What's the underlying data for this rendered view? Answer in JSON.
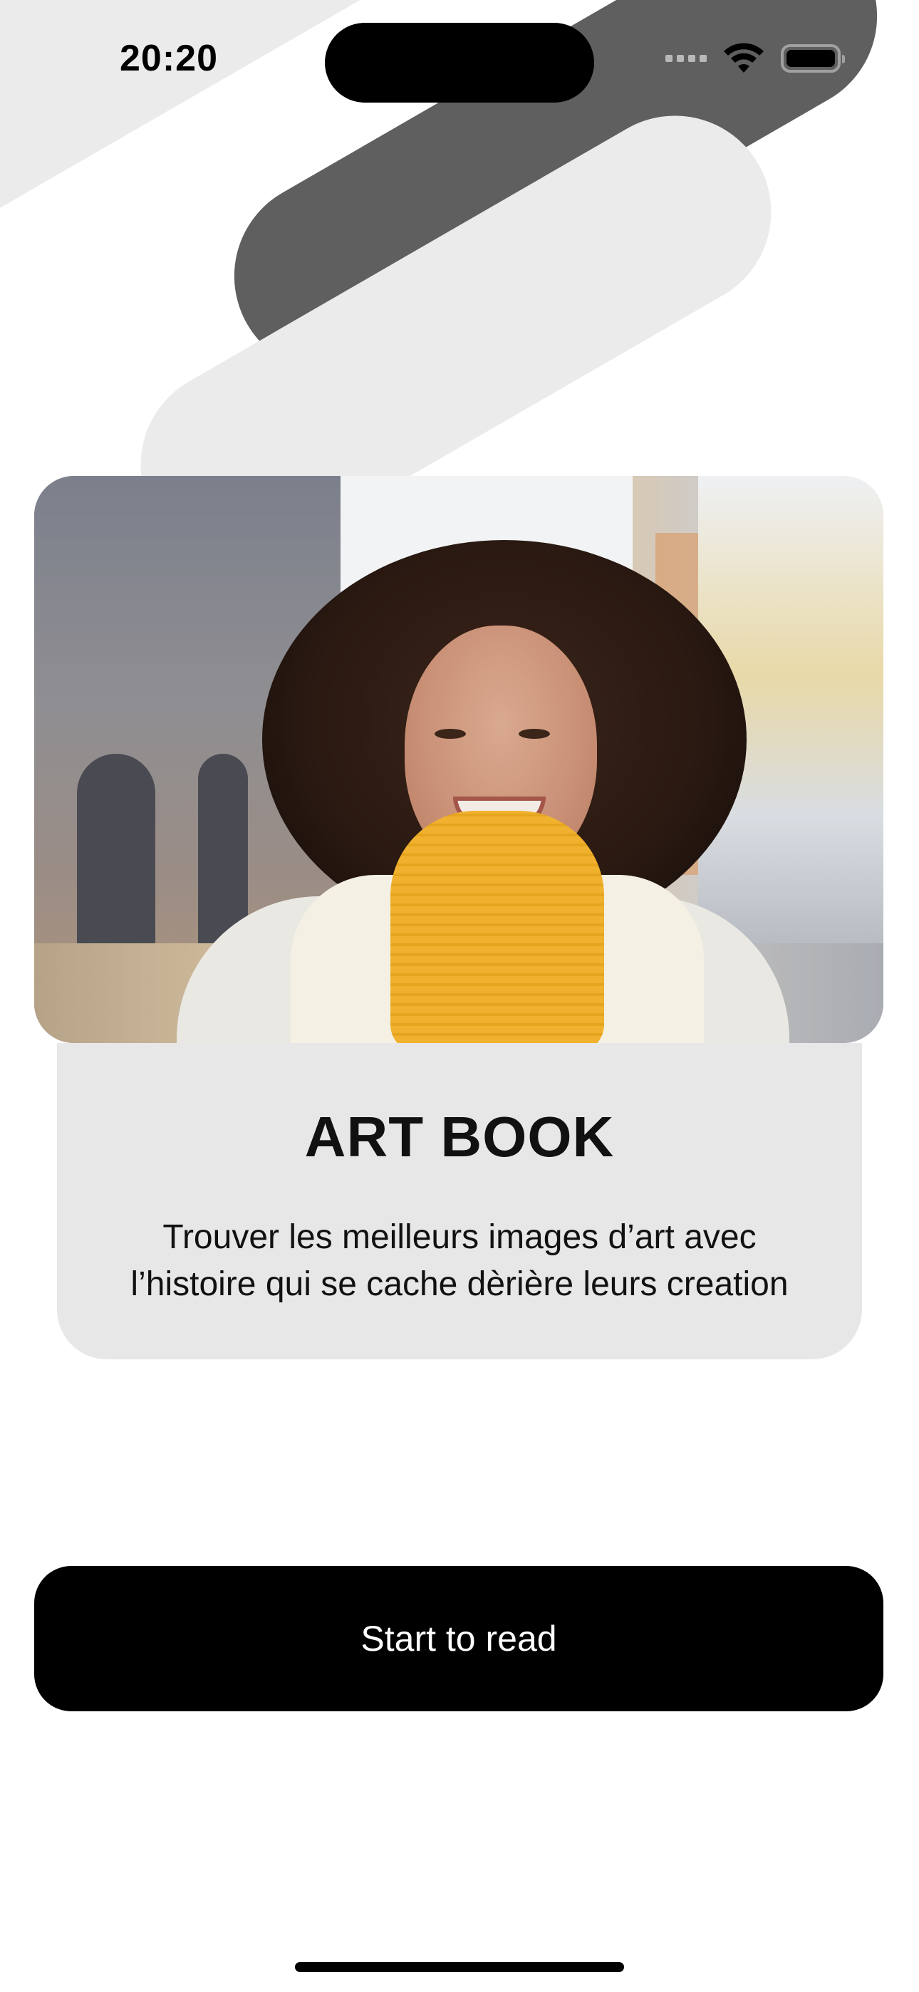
{
  "status_bar": {
    "time": "20:20"
  },
  "hero": {
    "image_description_icon": "portrait-photo"
  },
  "card": {
    "title": "ART BOOK",
    "description_line1": "Trouver les meilleurs images d’art avec",
    "description_line2": "l’histoire qui se cache dèrière leurs creation"
  },
  "actions": {
    "start_label": "Start to read"
  },
  "colors": {
    "background": "#ffffff",
    "pill_dark": "#5f5f5f",
    "pill_light": "#ebebeb",
    "card_bg": "#e7e7e7",
    "button_bg": "#000000",
    "button_text": "#ffffff"
  }
}
